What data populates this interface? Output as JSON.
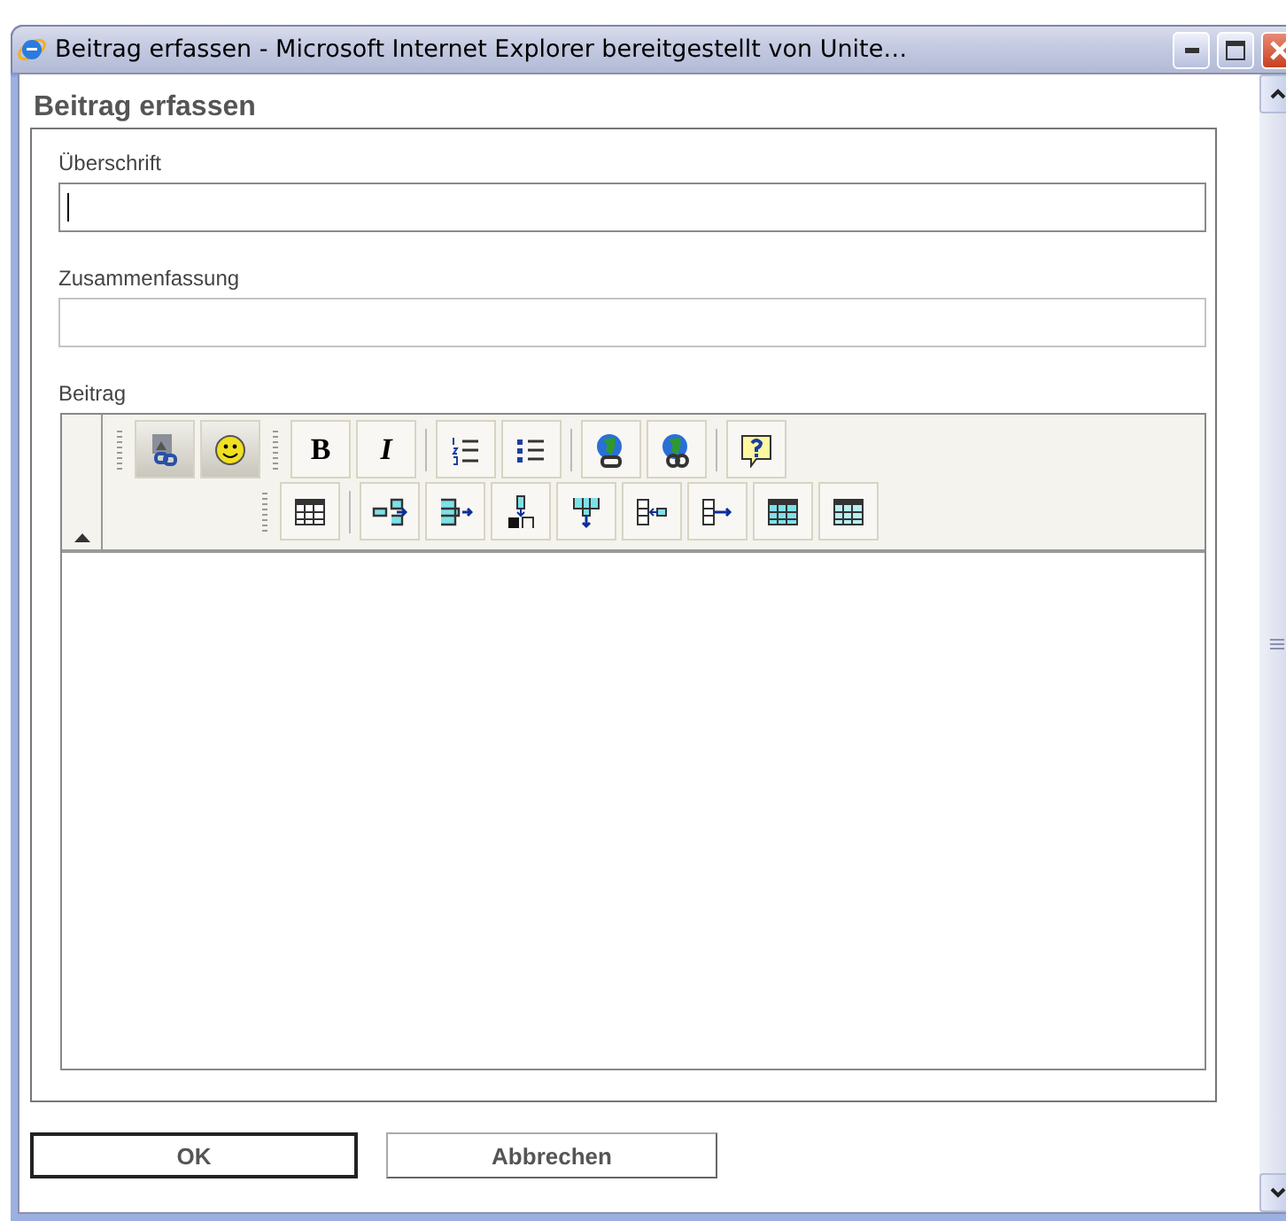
{
  "window": {
    "title": "Beitrag erfassen - Microsoft Internet Explorer bereitgestellt von Unite…"
  },
  "heading": "Beitrag erfassen",
  "fields": [
    {
      "label": "Überschrift",
      "focused": true
    },
    {
      "label": "Zusammenfassung",
      "focused": false
    }
  ],
  "editor": {
    "label": "Beitrag",
    "bold": "B",
    "italic": "I"
  },
  "buttons": [
    {
      "label": "OK",
      "default": true
    },
    {
      "label": "Abbrechen",
      "default": false
    }
  ]
}
